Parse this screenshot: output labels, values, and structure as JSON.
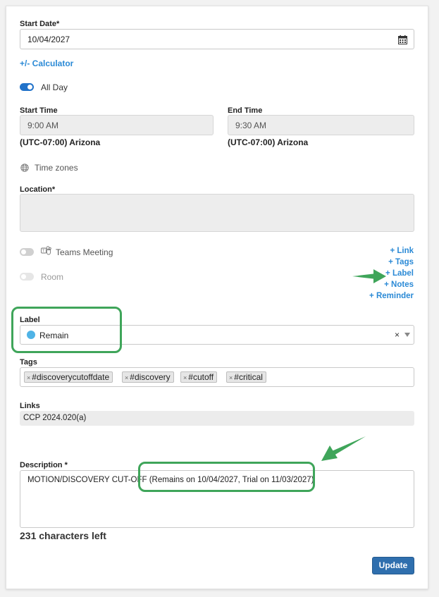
{
  "start_date": {
    "label": "Start Date*",
    "value": "10/04/2027"
  },
  "calculator_link": "+/- Calculator",
  "all_day": {
    "label": "All Day",
    "on": true
  },
  "start_time": {
    "label": "Start Time",
    "value": "9:00 AM",
    "timezone": "(UTC-07:00) Arizona"
  },
  "end_time": {
    "label": "End Time",
    "value": "9:30 AM",
    "timezone": "(UTC-07:00) Arizona"
  },
  "time_zones_link": "Time zones",
  "location": {
    "label": "Location*",
    "value": ""
  },
  "teams_meeting": {
    "label": "Teams Meeting",
    "on": false
  },
  "room": {
    "label": "Room",
    "on": false
  },
  "add_links": [
    "+ Link",
    "+ Tags",
    "+ Label",
    "+ Notes",
    "+ Reminder"
  ],
  "label_field": {
    "label": "Label",
    "value": "Remain",
    "color": "#4fb3e6"
  },
  "tags_field": {
    "label": "Tags",
    "tags": [
      "#discoverycutoffdate",
      "#discovery",
      "#cutoff",
      "#critical"
    ]
  },
  "links_field": {
    "label": "Links",
    "value": "CCP 2024.020(a)"
  },
  "description": {
    "label": "Description *",
    "value": "MOTION/DISCOVERY CUT-OFF (Remains on 10/04/2027, Trial on 11/03/2027)",
    "chars_left": "231 characters left"
  },
  "update_button": "Update",
  "colors": {
    "accent": "#2b8ad6",
    "annotation": "#3fa55a",
    "button": "#2f6fae"
  }
}
